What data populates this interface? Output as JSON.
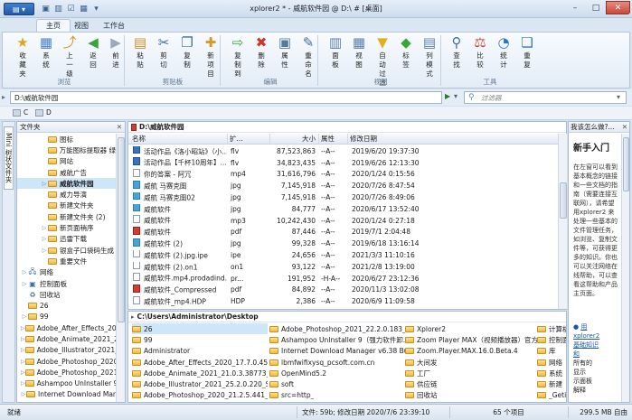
{
  "window": {
    "title": "xplorer2 * - 威航软件园 @ D:\\ # [桌面]",
    "buttons": [
      "–",
      "□",
      "✕"
    ]
  },
  "colors": {
    "accent": "#2a62b1",
    "ribbon_bg": "#eef4fb",
    "selection": "#cde6fa",
    "pdf": "#d83b2e",
    "folder": "#f2b93d"
  },
  "tabs": [
    {
      "label": "主页",
      "active": true
    },
    {
      "label": "视图",
      "active": false
    },
    {
      "label": "工作台",
      "active": false
    }
  ],
  "ribbon": {
    "buttons": [
      {
        "label": "收藏夹",
        "icon": "star-icon"
      },
      {
        "label": "系统",
        "icon": "system-icon"
      },
      {
        "label": "上一级",
        "icon": "folder-up-icon"
      },
      {
        "label": "返回",
        "icon": "back-icon"
      },
      {
        "label": "前进",
        "icon": "forward-icon"
      },
      {
        "label": "粘贴",
        "icon": "paste-icon"
      },
      {
        "label": "剪切",
        "icon": "cut-icon"
      },
      {
        "label": "复制",
        "icon": "copy-icon"
      },
      {
        "label": "新项目",
        "icon": "new-item-icon"
      },
      {
        "label": "复制到",
        "icon": "copy-to-icon"
      },
      {
        "label": "删除",
        "icon": "delete-icon"
      },
      {
        "label": "属性",
        "icon": "properties-icon"
      },
      {
        "label": "重命名",
        "icon": "rename-icon"
      },
      {
        "label": "面板",
        "icon": "panel-icon"
      },
      {
        "label": "视图",
        "icon": "view-icon"
      },
      {
        "label": "自动过滤",
        "icon": "filter-icon"
      },
      {
        "label": "标签",
        "icon": "tag-icon"
      },
      {
        "label": "列模式",
        "icon": "column-mode-icon"
      },
      {
        "label": "查找",
        "icon": "find-icon"
      },
      {
        "label": "比较",
        "icon": "compare-icon"
      },
      {
        "label": "统计",
        "icon": "stats-icon"
      },
      {
        "label": "重复",
        "icon": "duplicates-icon"
      }
    ],
    "groups": [
      "浏览",
      "剪贴板",
      "编辑",
      "视图",
      "工具"
    ]
  },
  "address": {
    "path": "D:\\威航软件园",
    "filter_placeholder": "过滤器"
  },
  "drives": [
    "C",
    "D"
  ],
  "folder_tree": {
    "header": "文件夹",
    "side_tab": "Mini 树状文件夹",
    "items": [
      {
        "label": "图标",
        "indent": 3,
        "exp": false
      },
      {
        "label": "万能图标提取器 绿",
        "indent": 3,
        "exp": false
      },
      {
        "label": "网站",
        "indent": 3,
        "exp": false
      },
      {
        "label": "威航广告",
        "indent": 3,
        "exp": false
      },
      {
        "label": "威航软件园",
        "indent": 3,
        "exp": true,
        "selected": true
      },
      {
        "label": "威力导演",
        "indent": 3,
        "exp": false
      },
      {
        "label": "新建文件夹",
        "indent": 3,
        "exp": false
      },
      {
        "label": "新建文件夹 (2)",
        "indent": 3,
        "exp": false
      },
      {
        "label": "新页面稍序",
        "indent": 3,
        "exp": true
      },
      {
        "label": "迅雷下载",
        "indent": 3,
        "exp": true
      },
      {
        "label": "银盒子口袋码生成",
        "indent": 3,
        "exp": true
      },
      {
        "label": "重要文件",
        "indent": 3,
        "exp": false
      },
      {
        "label": "网络",
        "indent": 1,
        "exp": true,
        "kind": "net"
      },
      {
        "label": "控制面板",
        "indent": 1,
        "exp": true,
        "kind": "ctl"
      },
      {
        "label": "回收站",
        "indent": 1,
        "exp": false,
        "kind": "bin"
      },
      {
        "label": "26",
        "indent": 1,
        "exp": false
      },
      {
        "label": "99",
        "indent": 1,
        "exp": true
      },
      {
        "label": "Adobe_After_Effects_2020",
        "indent": 1,
        "exp": true
      },
      {
        "label": "Adobe_Animate_2021_2",
        "indent": 1,
        "exp": true
      },
      {
        "label": "Adobe_Illustrator_2021_2",
        "indent": 1,
        "exp": true
      },
      {
        "label": "Adobe_Photoshop_2020",
        "indent": 1,
        "exp": true
      },
      {
        "label": "Adobe_Photoshop_2021",
        "indent": 1,
        "exp": true
      },
      {
        "label": "Ashampoo UnInstaller 9",
        "indent": 1,
        "exp": true
      },
      {
        "label": "Internet Download Mar",
        "indent": 1,
        "exp": true
      }
    ]
  },
  "top_pane": {
    "path": "D:\\威航软件园",
    "columns": [
      "名称",
      "扩...",
      "大小",
      "属性",
      "修改日期"
    ],
    "rows": [
      {
        "name": "活动作品《洛小昭站》（小...",
        "ext": "flv",
        "size": "87,523,863",
        "attr": "--A--",
        "date": "2019/6/20 19:37:30",
        "icon": "flv"
      },
      {
        "name": "活动作品【千杯10周年】...",
        "ext": "flv",
        "size": "34,823,435",
        "attr": "--A--",
        "date": "2019/6/26 12:13:30",
        "icon": "flv"
      },
      {
        "name": "你的答案 - 阿冗",
        "ext": "mp4",
        "size": "31,616,796",
        "attr": "--A--",
        "date": "2020/1/24 0:15:56",
        "icon": "file"
      },
      {
        "name": "威航 马赛克图",
        "ext": "jpg",
        "size": "7,145,918",
        "attr": "--A--",
        "date": "2020/7/26 8:47:54",
        "icon": "jpg"
      },
      {
        "name": "威航 马赛克图02",
        "ext": "jpg",
        "size": "7,145,918",
        "attr": "--A--",
        "date": "2020/7/26 8:49:06",
        "icon": "jpg"
      },
      {
        "name": "威航软件",
        "ext": "jpg",
        "size": "84,777",
        "attr": "--A--",
        "date": "2020/6/17 13:52:40",
        "icon": "jpg"
      },
      {
        "name": "威航软件",
        "ext": "mp3",
        "size": "10,242,430",
        "attr": "--A--",
        "date": "2020/1/24 0:27:18",
        "icon": "file"
      },
      {
        "name": "威航软件",
        "ext": "pdf",
        "size": "87,446",
        "attr": "--A--",
        "date": "2019/7/1 2:04:48",
        "icon": "pdf"
      },
      {
        "name": "威航软件 (2)",
        "ext": "jpg",
        "size": "99,328",
        "attr": "--A--",
        "date": "2019/6/18 13:16:14",
        "icon": "jpg"
      },
      {
        "name": "威航软件 (2).jpg.ipe",
        "ext": "ipe",
        "size": "24,656",
        "attr": "--A--",
        "date": "2021/3/3 11:10:16",
        "icon": "file"
      },
      {
        "name": "威航软件 (2).on1",
        "ext": "on1",
        "size": "93,122",
        "attr": "--A--",
        "date": "2021/2/8 13:19:00",
        "icon": "file"
      },
      {
        "name": "威航软件.mp4.prodadind...",
        "ext": "pr...",
        "size": "191,952",
        "attr": "-H-A--",
        "date": "2020/6/27 23:12:36",
        "icon": "file"
      },
      {
        "name": "威航软件_Compressed",
        "ext": "pdf",
        "size": "84,892",
        "attr": "--A--",
        "date": "2020/11/3 13:02:08",
        "icon": "pdf"
      },
      {
        "name": "威航软件_mp4.HDP",
        "ext": "HDP",
        "size": "2,386",
        "attr": "--A--",
        "date": "2020/6/9 11:09:58",
        "icon": "file"
      }
    ]
  },
  "bottom_pane": {
    "path": "C:\\Users\\Administrator\\Desktop",
    "col1": [
      "26",
      "99",
      "Administrator",
      "Adobe_After_Effects_2020_17.7.0.45_A...",
      "Adobe_Animate_2021_21.0.3.38773_A...",
      "Adobe_Illustrator_2021_25.2.0.220_SP...",
      "Adobe_Photoshop_2020_21.2.5.441_A..."
    ],
    "col2": [
      "Adobe_Photoshop_2021_22.2.0.183_A...",
      "Ashampoo UnInstaller 9（强力软件卸...",
      "Internet Download Manager v6.38 Bui...",
      "lbmfwifixysq_pcsoft.com.cn",
      "OpenMind5.2",
      "soft",
      "src=http_"
    ],
    "col3": [
      "Xplorer2",
      "Zoom Player MAX（视频播放器）官方...",
      "Zoom.Player.MAX.16.0.Beta.4",
      "大间发",
      "工厂",
      "供应链",
      "回收站"
    ],
    "col4": [
      "计算机",
      "控制面板",
      "库",
      "网络",
      "系统",
      "新建",
      "_Getin"
    ]
  },
  "preview": {
    "header": "我该怎么做?...",
    "title": "新手入门",
    "paragraphs": [
      "在左窗可以看到基本概念的链接和一些文档的指南（需要连接互联网），请希望用xplorer2 来处理一些基本的文件管理任务，如浏览、复制文件等，可获得更多的知识。你也可以关注网络在线帮助，可以查看这帮助和产品主页面。"
    ],
    "links": [
      "用",
      "xplorer2",
      "基础知识",
      "和",
      "所有的",
      "显示",
      "示面板",
      "解释"
    ]
  },
  "status": {
    "left": "就绪",
    "info": "文件: 59b; 修改日期 2020/7/6 23:39:10",
    "count": "65 个项目",
    "free": "299.5 MB 自由"
  }
}
